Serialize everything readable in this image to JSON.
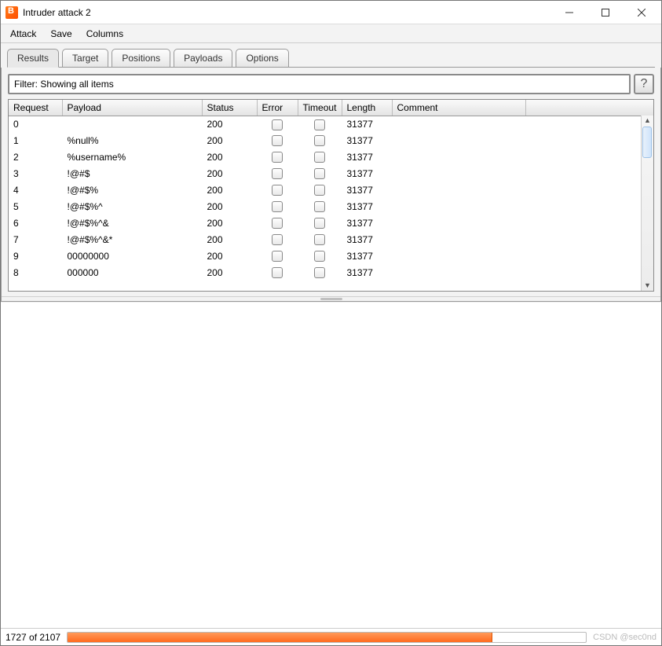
{
  "window": {
    "title": "Intruder attack 2"
  },
  "menu": {
    "items": [
      "Attack",
      "Save",
      "Columns"
    ]
  },
  "tabs": {
    "items": [
      "Results",
      "Target",
      "Positions",
      "Payloads",
      "Options"
    ],
    "active_index": 0
  },
  "filter": {
    "text": "Filter: Showing all items",
    "help_label": "?"
  },
  "table": {
    "columns": [
      "Request",
      "Payload",
      "Status",
      "Error",
      "Timeout",
      "Length",
      "Comment"
    ],
    "rows": [
      {
        "request": "0",
        "payload": "",
        "status": "200",
        "error": false,
        "timeout": false,
        "length": "31377",
        "comment": ""
      },
      {
        "request": "1",
        "payload": "%null%",
        "status": "200",
        "error": false,
        "timeout": false,
        "length": "31377",
        "comment": ""
      },
      {
        "request": "2",
        "payload": "%username%",
        "status": "200",
        "error": false,
        "timeout": false,
        "length": "31377",
        "comment": ""
      },
      {
        "request": "3",
        "payload": "!@#$",
        "status": "200",
        "error": false,
        "timeout": false,
        "length": "31377",
        "comment": ""
      },
      {
        "request": "4",
        "payload": "!@#$%",
        "status": "200",
        "error": false,
        "timeout": false,
        "length": "31377",
        "comment": ""
      },
      {
        "request": "5",
        "payload": "!@#$%^",
        "status": "200",
        "error": false,
        "timeout": false,
        "length": "31377",
        "comment": ""
      },
      {
        "request": "6",
        "payload": "!@#$%^&",
        "status": "200",
        "error": false,
        "timeout": false,
        "length": "31377",
        "comment": ""
      },
      {
        "request": "7",
        "payload": "!@#$%^&*",
        "status": "200",
        "error": false,
        "timeout": false,
        "length": "31377",
        "comment": ""
      },
      {
        "request": "9",
        "payload": "00000000",
        "status": "200",
        "error": false,
        "timeout": false,
        "length": "31377",
        "comment": ""
      },
      {
        "request": "8",
        "payload": "000000",
        "status": "200",
        "error": false,
        "timeout": false,
        "length": "31377",
        "comment": ""
      }
    ]
  },
  "status": {
    "text": "1727 of 2107",
    "progress_current": 1727,
    "progress_total": 2107
  },
  "watermark": "CSDN @sec0nd"
}
